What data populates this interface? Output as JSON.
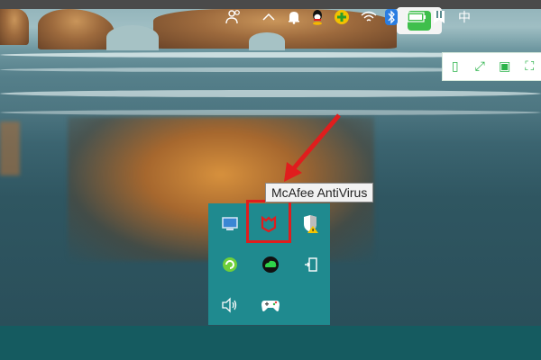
{
  "tooltip": {
    "text": "McAfee AntiVirus"
  },
  "tray_flyout": {
    "icons": [
      {
        "name": "network-monitor-icon"
      },
      {
        "name": "mcafee-icon"
      },
      {
        "name": "security-warning-icon"
      },
      {
        "name": "green-refresh-icon"
      },
      {
        "name": "green-cloud-icon"
      },
      {
        "name": "device-icon"
      },
      {
        "name": "speaker-icon"
      },
      {
        "name": "gamepad-icon"
      }
    ]
  },
  "toolbar": {
    "buttons": [
      {
        "name": "phone-icon",
        "glyph": "▯"
      },
      {
        "name": "expand-icon",
        "glyph": "⤢"
      },
      {
        "name": "save-icon",
        "glyph": "▣"
      },
      {
        "name": "fullscreen-icon",
        "glyph": "⛶"
      }
    ]
  },
  "taskbar": {
    "ime_label": "中",
    "icons": [
      "people-icon",
      "chevron-up-icon",
      "bell-icon",
      "qq-icon",
      "green-plus-icon",
      "wifi-icon",
      "bluetooth-icon",
      "battery-icon",
      "bookmark-icon"
    ]
  },
  "colors": {
    "highlight": "#e01d1d",
    "flyout": "#1f8a8f",
    "taskbar": "#155b60",
    "accent_green": "#2bb34a"
  }
}
